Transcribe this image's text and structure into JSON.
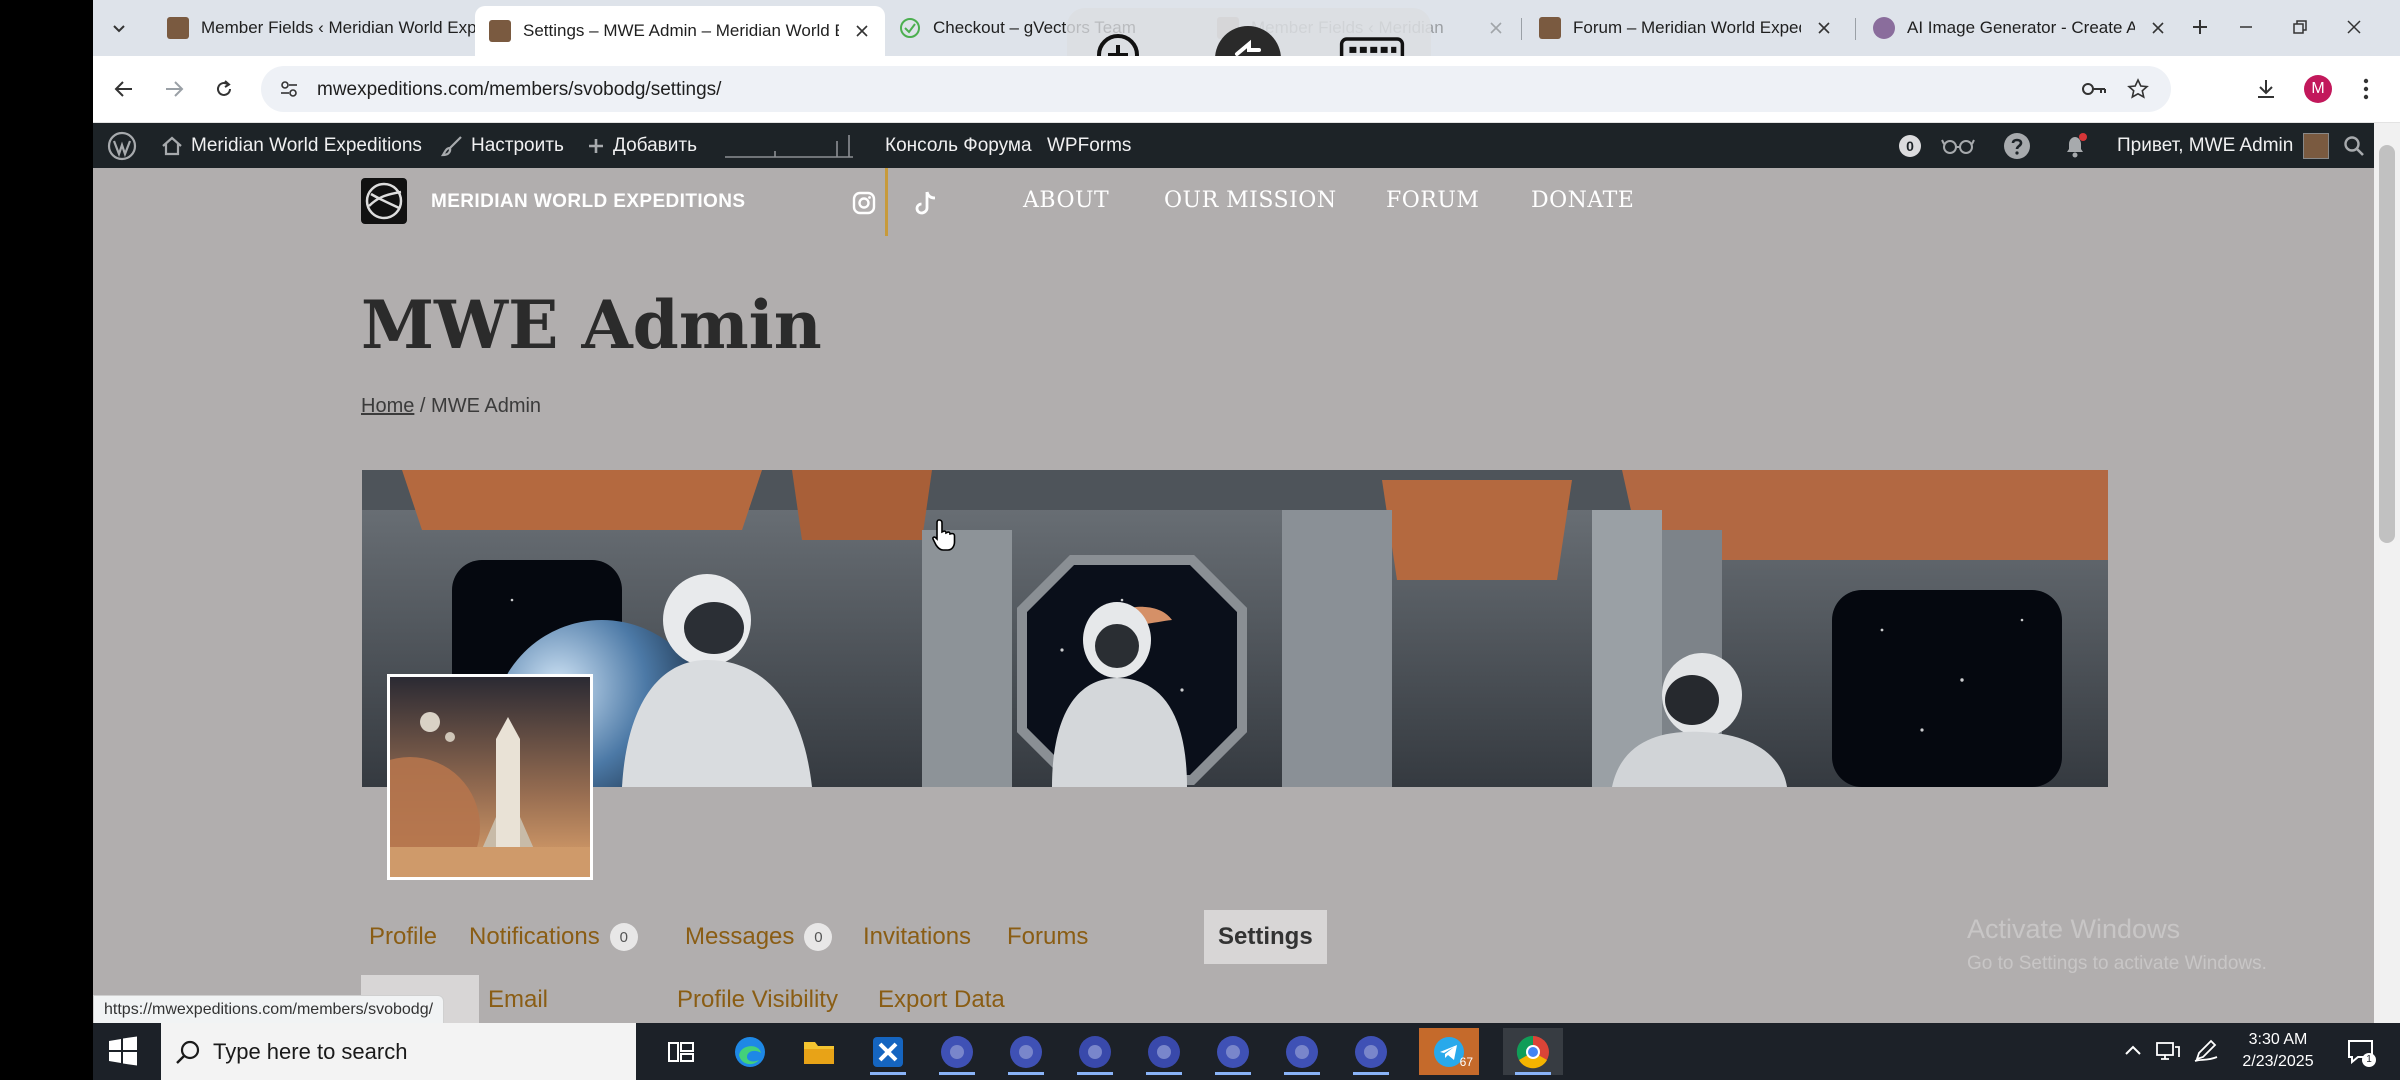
{
  "browser": {
    "tabs": [
      {
        "title": "Member Fields ‹ Meridian World Expeditions",
        "active": false
      },
      {
        "title": "Settings – MWE Admin – Meridian World Expeditions",
        "active": true
      },
      {
        "title": "Checkout – gVectors Team",
        "active": false
      },
      {
        "title": "Member Fields ‹ Meridian",
        "active": false
      },
      {
        "title": "Forum – Meridian World Expeditions",
        "active": false
      },
      {
        "title": "AI Image Generator - Create Art",
        "active": false
      }
    ],
    "url": "mwexpeditions.com/members/svobodg/settings/",
    "profile_initial": "M"
  },
  "admin_bar": {
    "site_name": "Meridian World Expeditions",
    "customize": "Настроить",
    "add_new": "Добавить",
    "forum_console": "Консоль Форума",
    "wpforms": "WPForms",
    "counter": "0",
    "greeting": "Привет, MWE Admin"
  },
  "site": {
    "title": "MERIDIAN WORLD EXPEDITIONS",
    "nav": [
      "ABOUT",
      "OUR MISSION",
      "FORUM",
      "DONATE"
    ]
  },
  "page": {
    "title": "MWE Admin",
    "breadcrumb_home": "Home",
    "breadcrumb_sep": " / ",
    "breadcrumb_current": "MWE Admin"
  },
  "profile_nav": [
    {
      "label": "Profile"
    },
    {
      "label": "Notifications",
      "count": "0"
    },
    {
      "label": "Messages",
      "count": "0"
    },
    {
      "label": "Invitations"
    },
    {
      "label": "Forums"
    },
    {
      "label": "Settings",
      "selected": true
    }
  ],
  "sub_nav": [
    {
      "label": "",
      "selected": true
    },
    {
      "label": "Email"
    },
    {
      "label": "Profile Visibility"
    },
    {
      "label": "Export Data"
    }
  ],
  "status_bar_url": "https://mwexpeditions.com/members/svobodg/",
  "watermark": {
    "line1": "Activate Windows",
    "line2": "Go to Settings to activate Windows."
  },
  "taskbar": {
    "search_placeholder": "Type here to search",
    "time": "3:30 AM",
    "date": "2/23/2025",
    "telegram_badge": "67",
    "notification_count": "1"
  },
  "colors": {
    "accent_link": "#8a5d14",
    "admin_bar": "#1d2327",
    "page_bg": "#b1aeae",
    "divider": "#c79a3b"
  }
}
